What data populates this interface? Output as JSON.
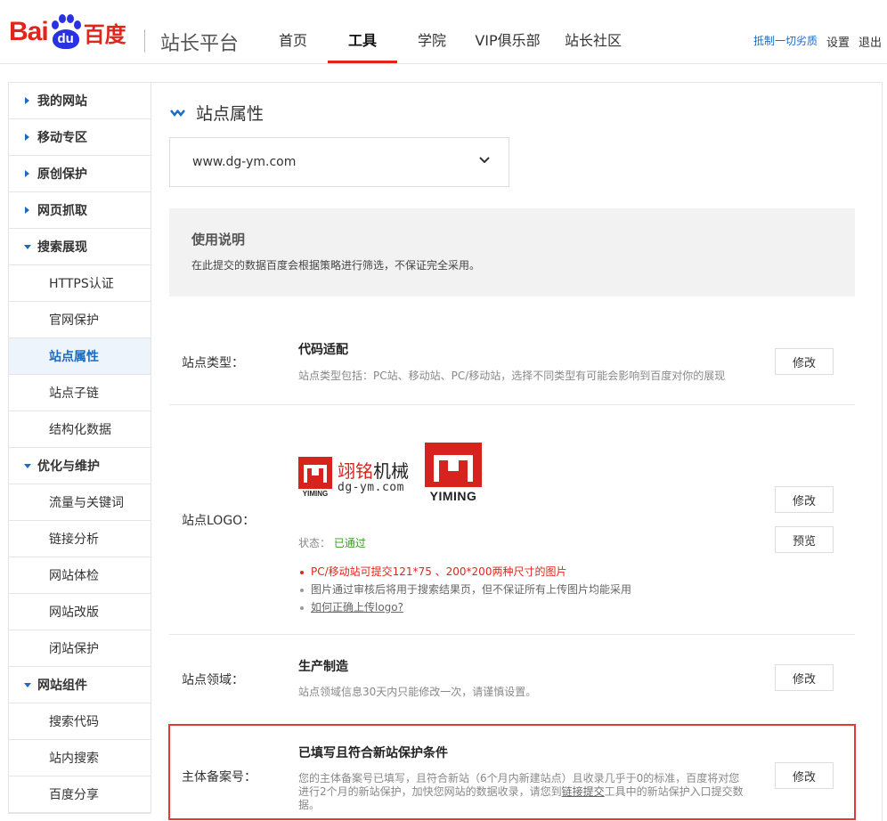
{
  "header": {
    "logo_bai": "Bai",
    "logo_du": "du",
    "logo_cn": "百度",
    "site_title": "站长平台",
    "nav": [
      "首页",
      "工具",
      "学院",
      "VIP俱乐部",
      "站长社区"
    ],
    "active_nav": "工具",
    "promo": "抵制一切劣质",
    "settings": "设置",
    "logout": "退出"
  },
  "sidebar": {
    "items": [
      {
        "label": "我的网站",
        "type": "group",
        "expanded": false
      },
      {
        "label": "移动专区",
        "type": "group",
        "expanded": false
      },
      {
        "label": "原创保护",
        "type": "group",
        "expanded": false
      },
      {
        "label": "网页抓取",
        "type": "group",
        "expanded": false
      },
      {
        "label": "搜索展现",
        "type": "group",
        "expanded": true
      },
      {
        "label": "HTTPS认证",
        "type": "sub"
      },
      {
        "label": "官网保护",
        "type": "sub"
      },
      {
        "label": "站点属性",
        "type": "sub",
        "current": true
      },
      {
        "label": "站点子链",
        "type": "sub"
      },
      {
        "label": "结构化数据",
        "type": "sub"
      },
      {
        "label": "优化与维护",
        "type": "group",
        "expanded": true
      },
      {
        "label": "流量与关键词",
        "type": "sub"
      },
      {
        "label": "链接分析",
        "type": "sub"
      },
      {
        "label": "网站体检",
        "type": "sub"
      },
      {
        "label": "网站改版",
        "type": "sub"
      },
      {
        "label": "闭站保护",
        "type": "sub"
      },
      {
        "label": "网站组件",
        "type": "group",
        "expanded": true
      },
      {
        "label": "搜索代码",
        "type": "sub"
      },
      {
        "label": "站内搜索",
        "type": "sub"
      },
      {
        "label": "百度分享",
        "type": "sub"
      }
    ]
  },
  "main": {
    "page_title": "站点属性",
    "site_select_value": "www.dg-ym.com",
    "notice": {
      "title": "使用说明",
      "text": "在此提交的数据百度会根据策略进行筛选，不保证完全采用。"
    },
    "site_type": {
      "label": "站点类型：",
      "title": "代码适配",
      "desc": "站点类型包括：PC站、移动站、PC/移动站，选择不同类型有可能会影响到百度对你的展现",
      "button": "修改"
    },
    "site_logo": {
      "label": "站点LOGO：",
      "logo1_cn_red": "翊铭",
      "logo1_cn": "机械",
      "logo1_url": "dg-ym.com",
      "logo1_small": "YIMING",
      "logo2_text": "YIMING",
      "status_label": "状态：",
      "status_value": "已通过",
      "rule1": "PC/移动站可提交121*75 、200*200两种尺寸的图片",
      "rule2": "图片通过审核后将用于搜索结果页，但不保证所有上传图片均能采用",
      "rule3": "如何正确上传logo?",
      "button_edit": "修改",
      "button_preview": "预览"
    },
    "site_domain": {
      "label": "站点领域：",
      "title": "生产制造",
      "desc": "站点领域信息30天内只能修改一次，请谨慎设置。",
      "button": "修改"
    },
    "icp": {
      "label": "主体备案号：",
      "title": "已填写且符合新站保护条件",
      "desc_part1": "您的主体备案号已填写，且符合新站（6个月内新建站点）且收录几乎于0的标准，百度将对您进行2个月的新站保护，加快您网站的数据收录，请您到",
      "desc_link": "链接提交",
      "desc_part2": "工具中的新站保护入口提交数据。",
      "button": "修改"
    }
  },
  "colors": {
    "brand_red": "#e1251b",
    "brand_blue": "#2932e1",
    "link_blue": "#1a6bc3",
    "status_green": "#3a9d23",
    "highlight_red": "#e03a3a"
  }
}
